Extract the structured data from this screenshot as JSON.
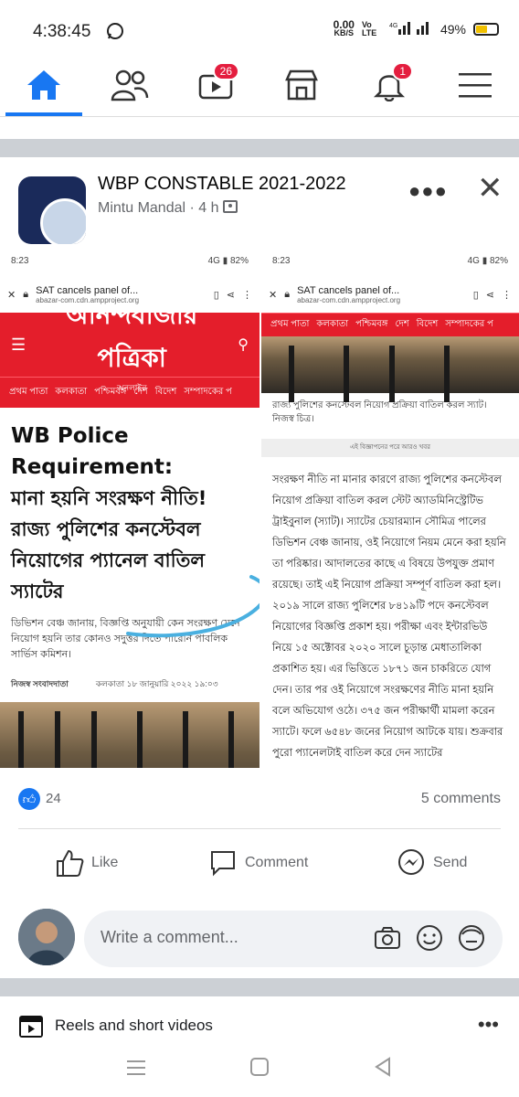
{
  "status_bar": {
    "time": "4:38:45",
    "speed_value": "0.00",
    "speed_unit": "KB/S",
    "volte": "Vo LTE",
    "network": "4G",
    "battery": "49%"
  },
  "nav": {
    "video_badge": "26",
    "notif_badge": "1"
  },
  "post": {
    "group_name": "WBP CONSTABLE 2021-2022",
    "author": "Mintu Mandal",
    "time": "4 h",
    "dot": "·",
    "left_shot": {
      "time": "8:23",
      "battery": "82%",
      "network": "4G",
      "tab_title": "SAT cancels panel of...",
      "url": "abazar-com.cdn.ampproject.org",
      "paper_name": "আনন্দবাজার পত্রিকা",
      "paper_sub": "অনলাইন",
      "categories": [
        "প্রথম পাতা",
        "কলকাতা",
        "পশ্চিমবঙ্গ",
        "দেশ",
        "বিদেশ",
        "সম্পাদকের প"
      ],
      "headline_en": "WB Police Requirement:",
      "headline_bn": "মানা হয়নি সংরক্ষণ নীতি! রাজ্য পুলিশের কনস্টেবল নিয়োগের প্যানেল বাতিল স্যাটের",
      "desc": "ডিভিশন বেঞ্চ জানায়, বিজ্ঞপ্তি অনুযায়ী কেন সংরক্ষণ মেনে নিয়োগ হয়নি তার কোনও সদুত্তর দিতে পারেনি পাবলিক সার্ভিস কমিশন।",
      "byline_author": "নিজস্ব সংবাদদাতা",
      "byline_date": "কলকাতা ১৮ জানুয়ারি ২০২২ ১৯:০৩"
    },
    "right_shot": {
      "time": "8:23",
      "battery": "82%",
      "network": "4G",
      "tab_title": "SAT cancels panel of...",
      "url": "abazar-com.cdn.ampproject.org",
      "categories": [
        "প্রথম পাতা",
        "কলকাতা",
        "পশ্চিমবঙ্গ",
        "দেশ",
        "বিদেশ",
        "সম্পাদকের প"
      ],
      "caption": "রাজ্য পুলিশের কনস্টেবল নিয়োগ প্রক্রিয়া বাতিল করল স্যাট। নিজস্ব চিত্র।",
      "ad_note": "এই বিজ্ঞাপনের পরে আরও খবর",
      "body": "সংরক্ষণ নীতি না মানার কারণে রাজ্য পুলিশের কনস্টেবল নিয়োগ প্রক্রিয়া বাতিল করল স্টেট অ্যাডমিনিস্ট্রেটিভ ট্রাইবুনাল (স্যাট)। স্যাটের চেয়ারম্যান সৌমিত্র পালের ডিভিশন বেঞ্চ জানায়, ওই নিয়োগে নিয়ম মেনে করা হয়নি তা পরিষ্কার। আদালতের কাছে এ বিষয়ে উপযুক্ত প্রমাণ রয়েছে। তাই এই নিয়োগ প্রক্রিয়া সম্পূর্ণ বাতিল করা হল। ২০১৯ সালে রাজ্য পুলিশের ৮৪১৯টি পদে কনস্টেবল নিয়োগের বিজ্ঞপ্তি প্রকাশ হয়। পরীক্ষা এবং ইন্টারভিউ নিয়ে ১৫ অক্টোবর ২০২০ সালে চূড়ান্ত মেধাতালিকা প্রকাশিত হয়। এর ভিত্তিতে ১৮৭১ জন চাকরিতে যোগ দেন। তার পর ওই নিয়োগে সংরক্ষণের নীতি মানা হয়নি বলে অভিযোগ ওঠে। ৩৭৫ জন পরীক্ষার্থী মামলা করেন স্যাটে। ফলে ৬৫৪৮ জনের নিয়োগ আটকে যায়। শুক্রবার পুরো প্যানেলটাই বাতিল করে দেন স্যাটের"
    },
    "likes": "24",
    "comments": "5 comments",
    "like_label": "Like",
    "comment_label": "Comment",
    "send_label": "Send",
    "comment_placeholder": "Write a comment..."
  },
  "reels": {
    "label": "Reels and short videos"
  },
  "colors": {
    "accent": "#1877f2",
    "badge": "#e41e3f",
    "paper_red": "#e41e2b"
  }
}
